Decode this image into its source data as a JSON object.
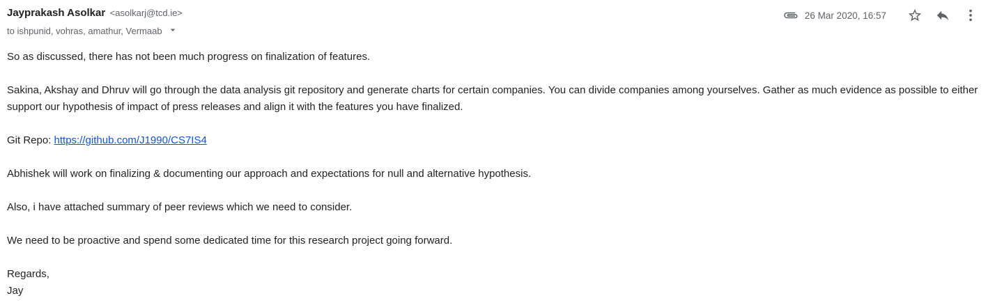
{
  "email": {
    "sender_name": "Jayprakash Asolkar",
    "sender_email": "<asolkarj@tcd.ie>",
    "recipients": "to ishpunid, vohras, amathur, Vermaab",
    "date": "26 Mar 2020, 16:57",
    "icons": {
      "attachment": "paperclip-icon",
      "star": "star-icon",
      "reply": "reply-icon",
      "more": "more-vert-icon",
      "recipients_toggle": "arrow-drop-down-icon"
    },
    "body": {
      "p1": "So as discussed, there has not been much progress on finalization of features.",
      "p2": "Sakina, Akshay and Dhruv will go through the data analysis git repository and generate charts for certain companies. You can divide companies among yourselves. Gather as much evidence as possible to either support our hypothesis of impact of press releases and align it with the features you have finalized.",
      "repo_label": "Git Repo: ",
      "repo_link": "https://github.com/J1990/CS7IS4",
      "p4": "Abhishek will work on finalizing & documenting our approach and expectations for null and alternative hypothesis.",
      "p5": "Also, i have attached summary of peer reviews which we need to consider.",
      "p6": "We need to be proactive and spend some dedicated time for this research project going forward.",
      "closing": "Regards,",
      "signature": "Jay"
    },
    "colors": {
      "link": "#1155cc",
      "text": "#222222",
      "secondary": "#5f6368"
    }
  }
}
